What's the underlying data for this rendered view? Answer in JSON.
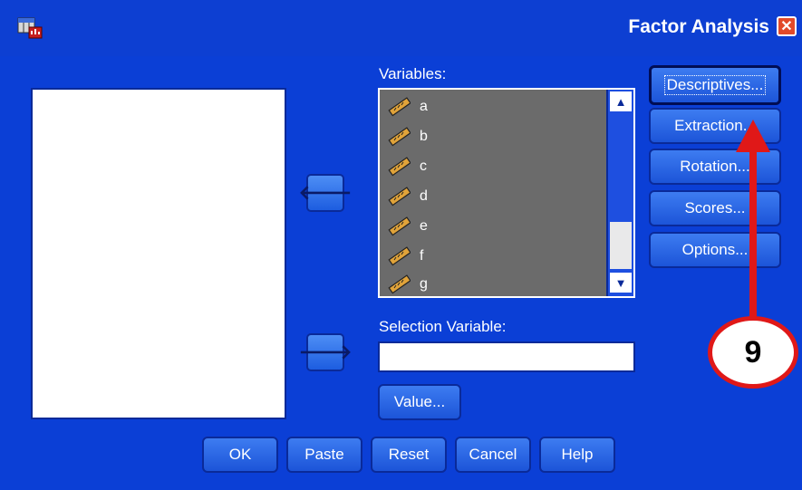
{
  "window": {
    "title": "Factor Analysis",
    "app_icon": "spss-table-icon",
    "close_icon": "close-icon",
    "close_symbol": "✕"
  },
  "variables": {
    "label": "Variables:",
    "items": [
      "a",
      "b",
      "c",
      "d",
      "e",
      "f",
      "g"
    ],
    "item_icon": "scale-ruler-icon"
  },
  "move_buttons": {
    "move_to_source_symbol": "🡐",
    "move_to_selection_symbol": "🡒"
  },
  "selection": {
    "label": "Selection Variable:",
    "value": "",
    "value_button": "Value..."
  },
  "side_buttons": {
    "descriptives": "Descriptives...",
    "extraction": "Extraction...",
    "rotation": "Rotation...",
    "scores": "Scores...",
    "options": "Options..."
  },
  "bottom_buttons": {
    "ok": "OK",
    "paste": "Paste",
    "reset": "Reset",
    "cancel": "Cancel",
    "help": "Help"
  },
  "scrollbar": {
    "up_symbol": "▲",
    "down_symbol": "▼"
  },
  "annotation": {
    "step_number": "9",
    "color": "#e01818"
  },
  "colors": {
    "window_bg": "#0b3fd6",
    "button_face": "#2a66e6",
    "list_bg": "#6b6b6b"
  }
}
